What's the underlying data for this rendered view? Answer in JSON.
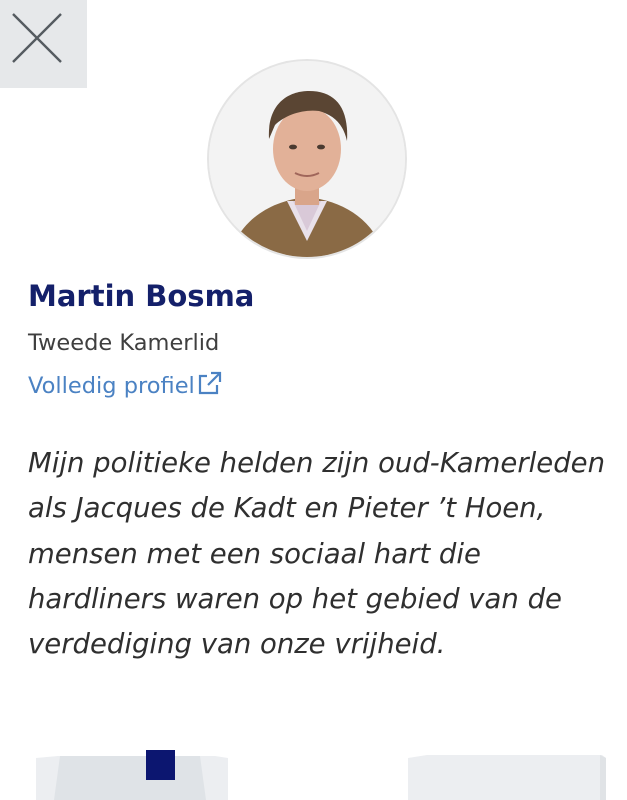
{
  "header": {
    "close_icon": "close-icon"
  },
  "profile": {
    "avatar_icon": "portrait-photo",
    "name": "Martin Bosma",
    "role": "Tweede Kamerlid",
    "link_label": "Volledig profiel",
    "link_icon": "external-link-icon"
  },
  "quote": {
    "text": "Mijn politieke helden zijn oud-Kamerleden als Jacques de Kadt en Pieter ’t Hoen, mensen met een sociaal hart die hardliners waren op het gebied van de verdediging van onze vrijheid."
  },
  "colors": {
    "name": "#14206a",
    "link": "#4b82c3",
    "close_bg": "#e6e8ea",
    "accent_block": "#0c1670"
  }
}
